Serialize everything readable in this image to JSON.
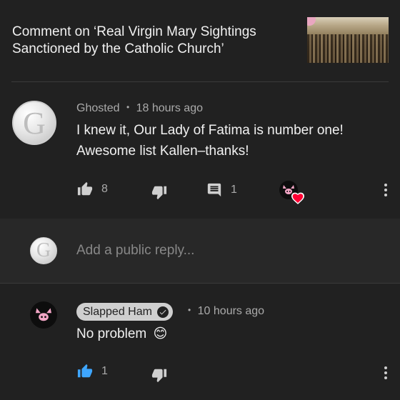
{
  "header": {
    "title": "Comment on ‘Real Virgin Mary Sightings\nSanctioned by the Catholic Church’"
  },
  "comment": {
    "avatar_letter": "G",
    "author": "Ghosted",
    "separator": "•",
    "time": "18 hours ago",
    "text_line1": "I knew it, Our Lady of Fatima is number one!",
    "text_line2": "Awesome list Kallen–thanks!",
    "likes": "8",
    "replies": "1"
  },
  "reply_box": {
    "avatar_letter": "G",
    "placeholder": "Add a public reply..."
  },
  "reply": {
    "author": "Slapped Ham",
    "separator": "•",
    "time": "10 hours ago",
    "text": "No problem",
    "emoji": "😊",
    "likes": "1"
  },
  "colors": {
    "background": "#212121",
    "reply_box_background": "#282828",
    "like_active": "#3ea6ff",
    "heart": "#ff0033"
  }
}
